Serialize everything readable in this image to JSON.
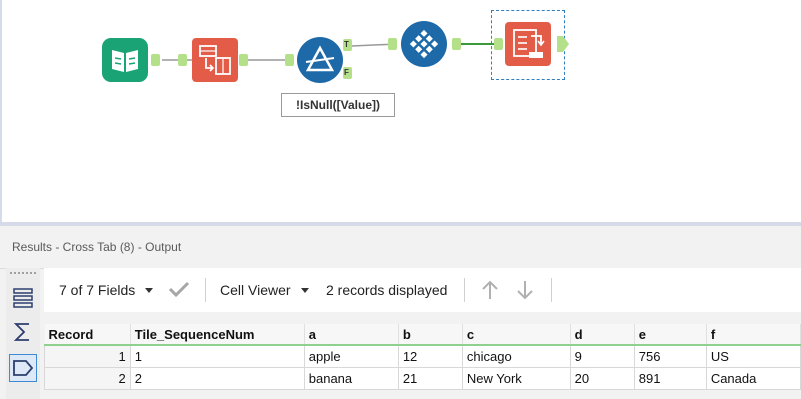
{
  "workflow": {
    "filter_annotation": "!IsNull([Value])",
    "filter_true_anchor": "T",
    "filter_false_anchor": "F",
    "tools": [
      {
        "name": "input-data",
        "color": "#1aa374"
      },
      {
        "name": "transpose",
        "color": "#e25c48"
      },
      {
        "name": "filter",
        "color": "#1e6aa8"
      },
      {
        "name": "tile",
        "color": "#1e6aa8"
      },
      {
        "name": "cross-tab",
        "color": "#e25c48"
      }
    ]
  },
  "results": {
    "title": "Results - Cross Tab (8) - Output",
    "fields_label": "7 of 7 Fields",
    "cell_viewer_label": "Cell Viewer",
    "records_label": "2 records displayed",
    "columns": [
      "Record",
      "Tile_SequenceNum",
      "a",
      "b",
      "c",
      "d",
      "e",
      "f"
    ],
    "rows": [
      [
        "1",
        "1",
        "apple",
        "12",
        "chicago",
        "9",
        "756",
        "US"
      ],
      [
        "2",
        "2",
        "banana",
        "21",
        "New York",
        "20",
        "891",
        "Canada"
      ]
    ]
  }
}
